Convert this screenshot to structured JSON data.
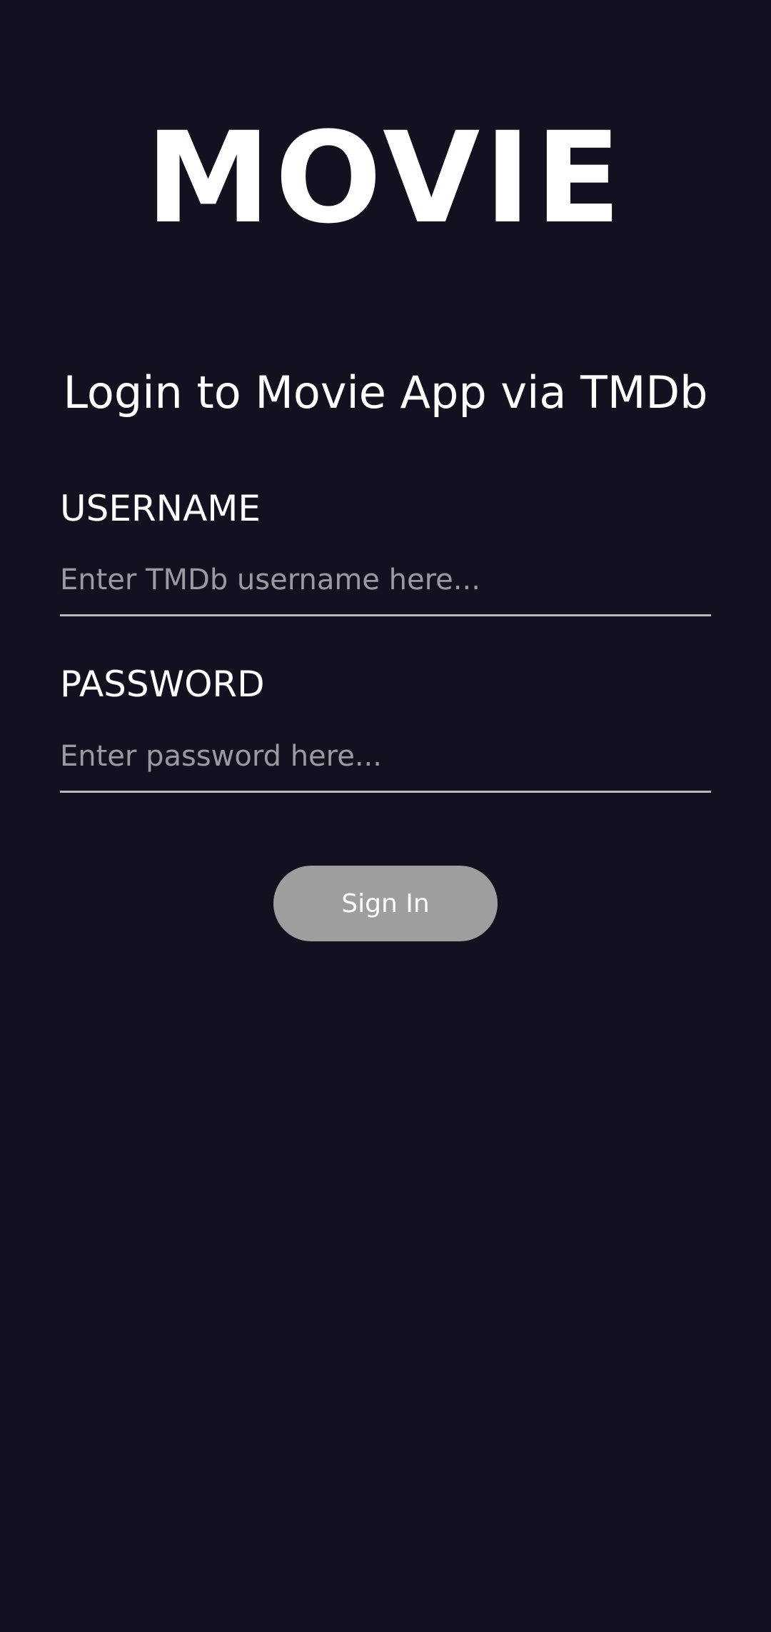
{
  "app": {
    "logo_text": "MOVIE"
  },
  "login": {
    "heading": "Login to Movie App via TMDb",
    "username": {
      "label": "USERNAME",
      "placeholder": "Enter TMDb username here...",
      "value": ""
    },
    "password": {
      "label": "PASSWORD",
      "placeholder": "Enter password here...",
      "value": ""
    },
    "signin_label": "Sign In"
  },
  "colors": {
    "background": "#13111f",
    "text": "#ffffff",
    "placeholder": "#9b99a1",
    "underline": "#b9b8bf",
    "button": "#9e9e9e"
  }
}
